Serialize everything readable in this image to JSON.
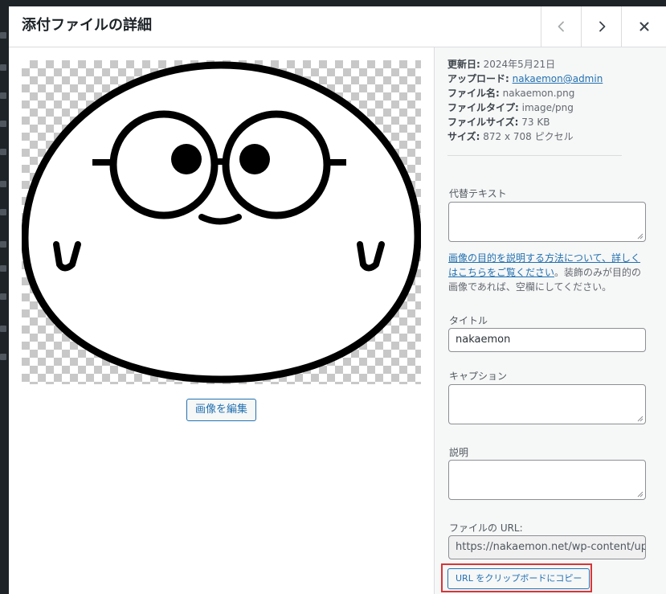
{
  "modal": {
    "title": "添付ファイルの詳細",
    "prev_label": "前へ",
    "next_label": "次へ",
    "close_label": "閉じる"
  },
  "preview": {
    "edit_image_label": "画像を編集"
  },
  "details": {
    "updated_label": "更新日:",
    "updated_value": "2024年5月21日",
    "uploaded_by_label": "アップロード:",
    "uploaded_by_value": "nakaemon@admin",
    "file_name_label": "ファイル名:",
    "file_name_value": "nakaemon.png",
    "file_type_label": "ファイルタイプ:",
    "file_type_value": "image/png",
    "file_size_label": "ファイルサイズ:",
    "file_size_value": "73 KB",
    "dimensions_label": "サイズ:",
    "dimensions_value": "872 x 708 ピクセル"
  },
  "fields": {
    "alt_text_label": "代替テキスト",
    "alt_text_value": "",
    "alt_help_link": "画像の目的を説明する方法について、詳しくはこちらをご覧ください",
    "alt_help_text": "。装飾のみが目的の画像であれば、空欄にしてください。",
    "title_label": "タイトル",
    "title_value": "nakaemon",
    "caption_label": "キャプション",
    "caption_value": "",
    "description_label": "説明",
    "description_value": "",
    "file_url_label": "ファイルの URL:",
    "file_url_value": "https://nakaemon.net/wp-content/up",
    "copy_url_label": "URL をクリップボードにコピー"
  },
  "colors": {
    "link": "#2271b1",
    "highlight": "#d63638",
    "panel_bg": "#f6f7f7"
  },
  "icons": {
    "prev": "chevron-left-icon",
    "next": "chevron-right-icon",
    "close": "close-icon"
  }
}
